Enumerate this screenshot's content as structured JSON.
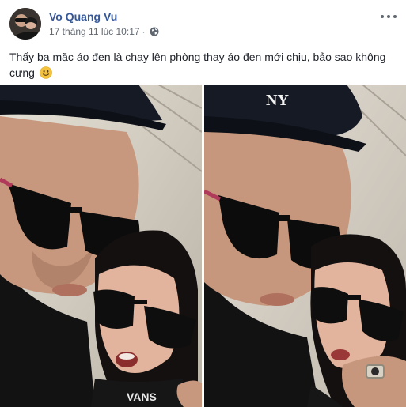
{
  "post": {
    "author": "Vo Quang Vu",
    "timestamp": "17 tháng 11 lúc 10:17",
    "separator": "·",
    "privacy_icon": "globe-icon",
    "more_icon": "more-options-icon",
    "caption": "Thấy ba mặc áo đen là chạy lên phòng thay áo đen mới chịu, bảo sao không cưng",
    "caption_emoji": "slightly-smiling-face-emoji",
    "photos": [
      {
        "cap_text": "",
        "shirt_text": "VANS"
      },
      {
        "cap_text": "NY",
        "shirt_text": ""
      }
    ]
  },
  "colors": {
    "link": "#365899",
    "meta": "#616770",
    "text": "#1d2129"
  }
}
